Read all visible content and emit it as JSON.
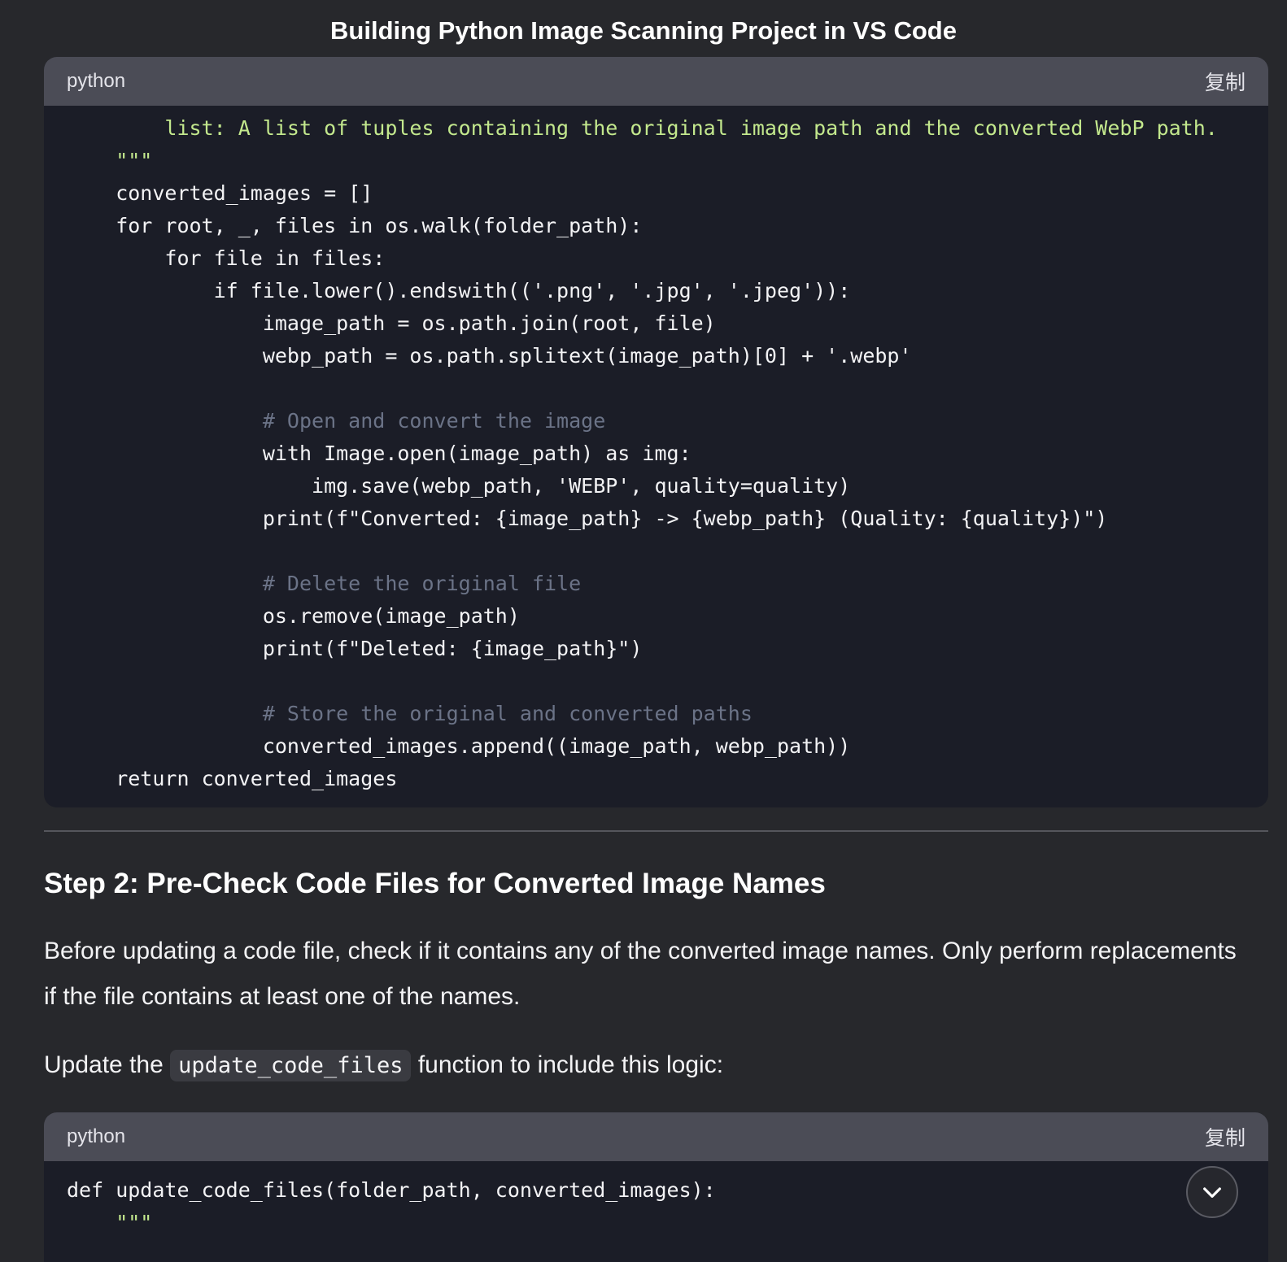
{
  "title": "Building Python Image Scanning Project in VS Code",
  "code_block_1": {
    "language": "python",
    "copy_label": "复制",
    "lines": [
      "        list: A list of tuples containing the original image path and the converted WebP path.",
      "    \"\"\"",
      "    converted_images = []",
      "    for root, _, files in os.walk(folder_path):",
      "        for file in files:",
      "            if file.lower().endswith(('.png', '.jpg', '.jpeg')):",
      "                image_path = os.path.join(root, file)",
      "                webp_path = os.path.splitext(image_path)[0] + '.webp'",
      "",
      "                # Open and convert the image",
      "                with Image.open(image_path) as img:",
      "                    img.save(webp_path, 'WEBP', quality=quality)",
      "                print(f\"Converted: {image_path} -> {webp_path} (Quality: {quality})\")",
      "",
      "                # Delete the original file",
      "                os.remove(image_path)",
      "                print(f\"Deleted: {image_path}\")",
      "",
      "                # Store the original and converted paths",
      "                converted_images.append((image_path, webp_path))",
      "    return converted_images"
    ]
  },
  "step2": {
    "heading": "Step 2: Pre-Check Code Files for Converted Image Names",
    "paragraph": "Before updating a code file, check if it contains any of the converted image names. Only perform replacements if the file contains at least one of the names.",
    "update_prefix": "Update the",
    "inline_code": "update_code_files",
    "update_suffix": "function to include this logic:"
  },
  "code_block_2": {
    "language": "python",
    "copy_label": "复制",
    "lines": [
      "def update_code_files(folder_path, converted_images):",
      "    \"\"\""
    ]
  },
  "scroll_button": {
    "icon": "chevron-down-icon"
  }
}
